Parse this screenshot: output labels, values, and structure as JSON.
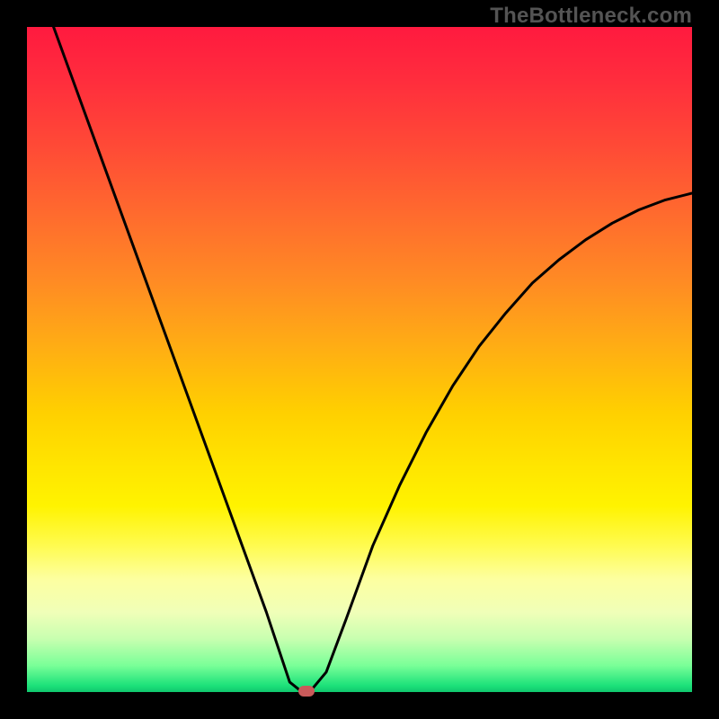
{
  "watermark": {
    "text": "TheBottleneck.com"
  },
  "colors": {
    "curve_stroke": "#000000",
    "marker_fill": "#c95a5a",
    "frame_bg": "#000000"
  },
  "chart_data": {
    "type": "line",
    "title": "",
    "xlabel": "",
    "ylabel": "",
    "xlim": [
      0,
      100
    ],
    "ylim": [
      0,
      100
    ],
    "grid": false,
    "legend": false,
    "series": [
      {
        "name": "bottleneck-curve",
        "x": [
          4,
          8,
          12,
          16,
          20,
          24,
          28,
          32,
          36,
          38,
          39.5,
          41,
          42,
          43,
          45,
          48,
          52,
          56,
          60,
          64,
          68,
          72,
          76,
          80,
          84,
          88,
          92,
          96,
          100
        ],
        "y": [
          100,
          89,
          78,
          67,
          56,
          45,
          34,
          23,
          12,
          6,
          1.5,
          0.3,
          0.2,
          0.6,
          3,
          11,
          22,
          31,
          39,
          46,
          52,
          57,
          61.5,
          65,
          68,
          70.5,
          72.5,
          74,
          75
        ]
      }
    ],
    "marker": {
      "x": 42,
      "y": 0.2
    }
  }
}
